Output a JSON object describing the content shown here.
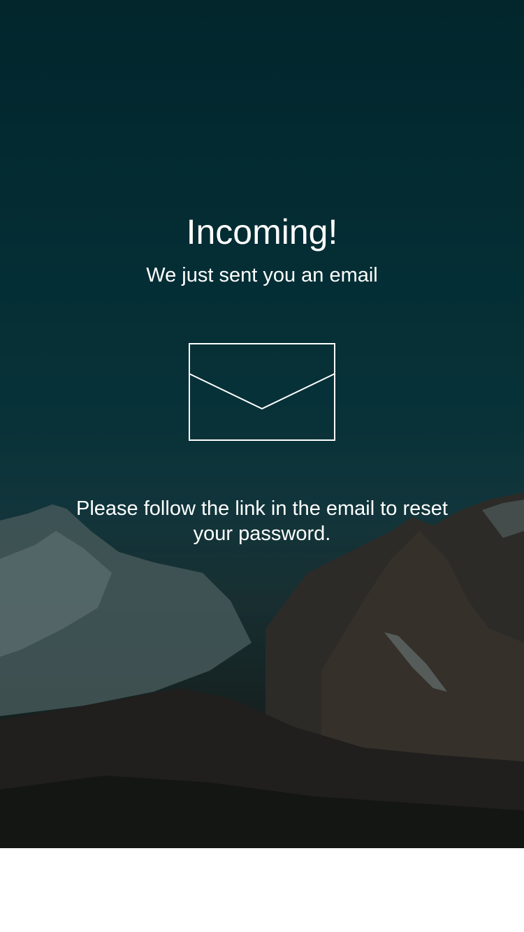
{
  "screen": {
    "title": "Incoming!",
    "subtitle": "We just sent you an email",
    "message": "Please follow the link in the email to reset your password."
  },
  "icons": {
    "envelope": "envelope-icon"
  },
  "colors": {
    "text": "#ffffff",
    "background_top": "#022a31",
    "background_bottom": "#14110e",
    "footer": "#ffffff"
  }
}
